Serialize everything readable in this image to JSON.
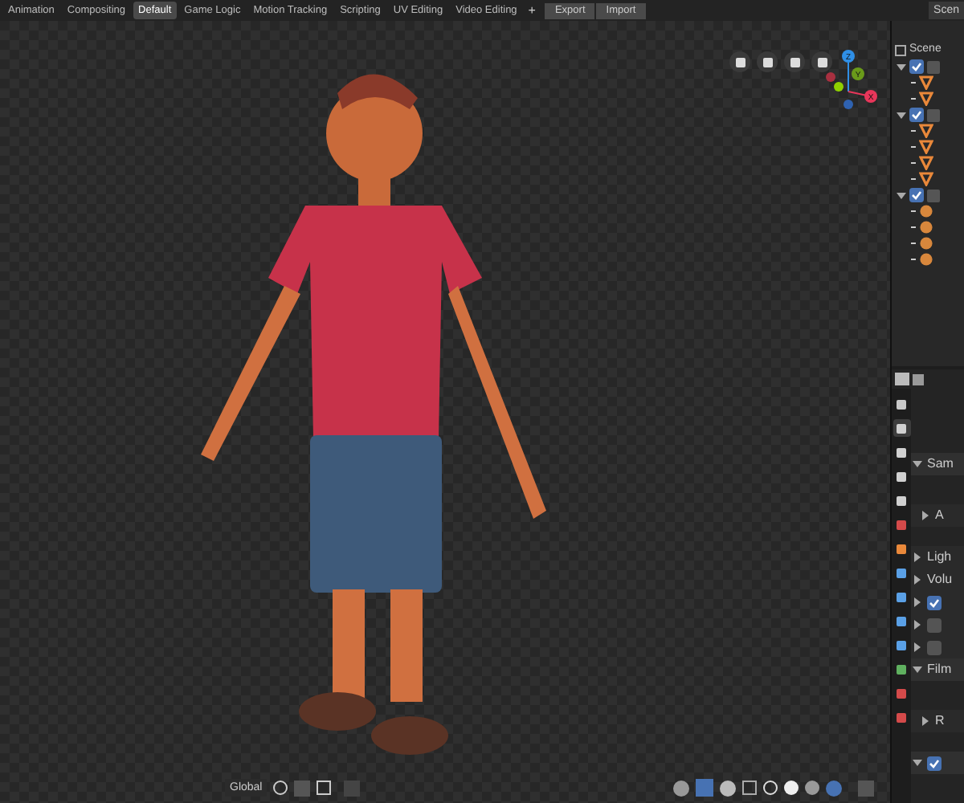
{
  "workspace_tabs": [
    {
      "label": "Animation",
      "selected": false
    },
    {
      "label": "Compositing",
      "selected": false
    },
    {
      "label": "Default",
      "selected": true
    },
    {
      "label": "Game Logic",
      "selected": false
    },
    {
      "label": "Motion Tracking",
      "selected": false
    },
    {
      "label": "Scripting",
      "selected": false
    },
    {
      "label": "UV Editing",
      "selected": false
    },
    {
      "label": "Video Editing",
      "selected": false
    }
  ],
  "add_tab": "+",
  "header_buttons": [
    "Export",
    "Import"
  ],
  "viewport": {
    "gizmo_axes": [
      {
        "label": "Z",
        "color": "#2f8fe6"
      },
      {
        "label": "Y",
        "color": "#6a9a1a"
      },
      {
        "label": "X",
        "color": "#e8365a"
      }
    ],
    "transform_orientation": "Global"
  },
  "outliner": {
    "scene_selector": "Scen",
    "root": "Scene",
    "collections": [
      {
        "checked": true,
        "children": [
          {
            "kind": "armature"
          },
          {
            "kind": "armature"
          }
        ]
      },
      {
        "checked": true,
        "children": [
          {
            "kind": "armature"
          },
          {
            "kind": "armature"
          },
          {
            "kind": "armature"
          },
          {
            "kind": "armature"
          }
        ]
      },
      {
        "checked": true,
        "children": [
          {
            "kind": "mesh"
          },
          {
            "kind": "mesh"
          },
          {
            "kind": "mesh"
          },
          {
            "kind": "mesh"
          }
        ]
      }
    ]
  },
  "properties": {
    "tabs": [
      {
        "kind": "tool",
        "selected": false
      },
      {
        "kind": "render",
        "selected": true
      },
      {
        "kind": "output",
        "selected": false
      },
      {
        "kind": "view",
        "selected": false
      },
      {
        "kind": "scene",
        "selected": false
      },
      {
        "kind": "world",
        "selected": false
      },
      {
        "kind": "object",
        "selected": false
      },
      {
        "kind": "modifier",
        "selected": false
      },
      {
        "kind": "particles",
        "selected": false
      },
      {
        "kind": "physics",
        "selected": false
      },
      {
        "kind": "constraint",
        "selected": false
      },
      {
        "kind": "data",
        "selected": false
      },
      {
        "kind": "material",
        "selected": false
      },
      {
        "kind": "texture",
        "selected": false
      }
    ],
    "rows": [
      {
        "kind": "panel",
        "label": "Sam",
        "expanded": true,
        "children": [
          {
            "label": "A",
            "expanded": false
          }
        ]
      },
      {
        "kind": "panel",
        "label": "Ligh",
        "expanded": false
      },
      {
        "kind": "panel",
        "label": "Volu",
        "expanded": false
      },
      {
        "kind": "check",
        "checked": true,
        "expanded": false
      },
      {
        "kind": "check",
        "checked": false,
        "expanded": false
      },
      {
        "kind": "check",
        "checked": false,
        "expanded": false
      },
      {
        "kind": "panel",
        "label": "Film",
        "expanded": true,
        "children": [
          {
            "label": "R",
            "expanded": false
          }
        ]
      },
      {
        "kind": "check",
        "checked": true,
        "expanded": true
      }
    ]
  }
}
